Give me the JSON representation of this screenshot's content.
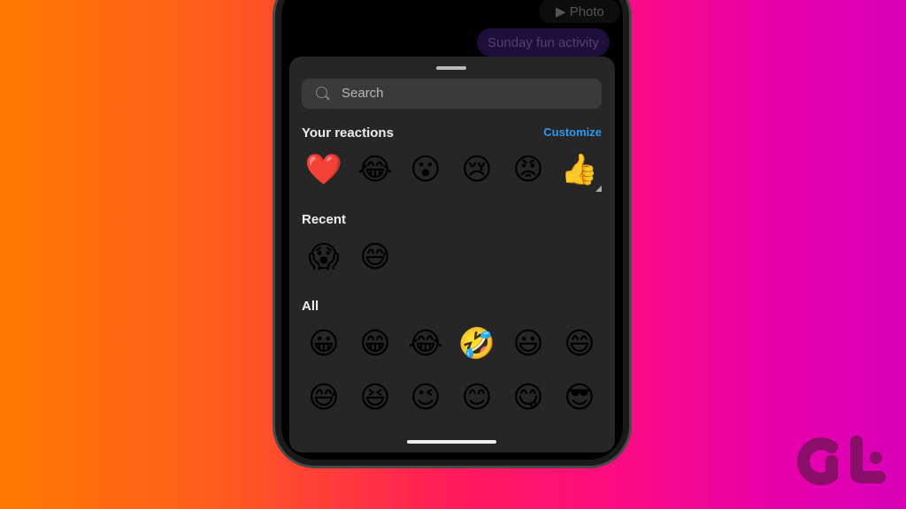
{
  "chat": {
    "photo_label": "▶ Photo",
    "message": "Sunday fun activity"
  },
  "search": {
    "placeholder": "Search"
  },
  "reactions": {
    "title": "Your reactions",
    "customize": "Customize",
    "emojis": [
      "❤️",
      "😂",
      "😮",
      "😢",
      "😡",
      "👍"
    ]
  },
  "recent": {
    "title": "Recent",
    "emojis": [
      "😱",
      "😅"
    ]
  },
  "all": {
    "title": "All",
    "emojis": [
      "😀",
      "😁",
      "😂",
      "🤣",
      "😃",
      "😄",
      "😅",
      "😆",
      "😉",
      "😊",
      "😋",
      "😎"
    ]
  },
  "logo": {
    "text": "GT",
    "color": "#8a0f6a"
  }
}
